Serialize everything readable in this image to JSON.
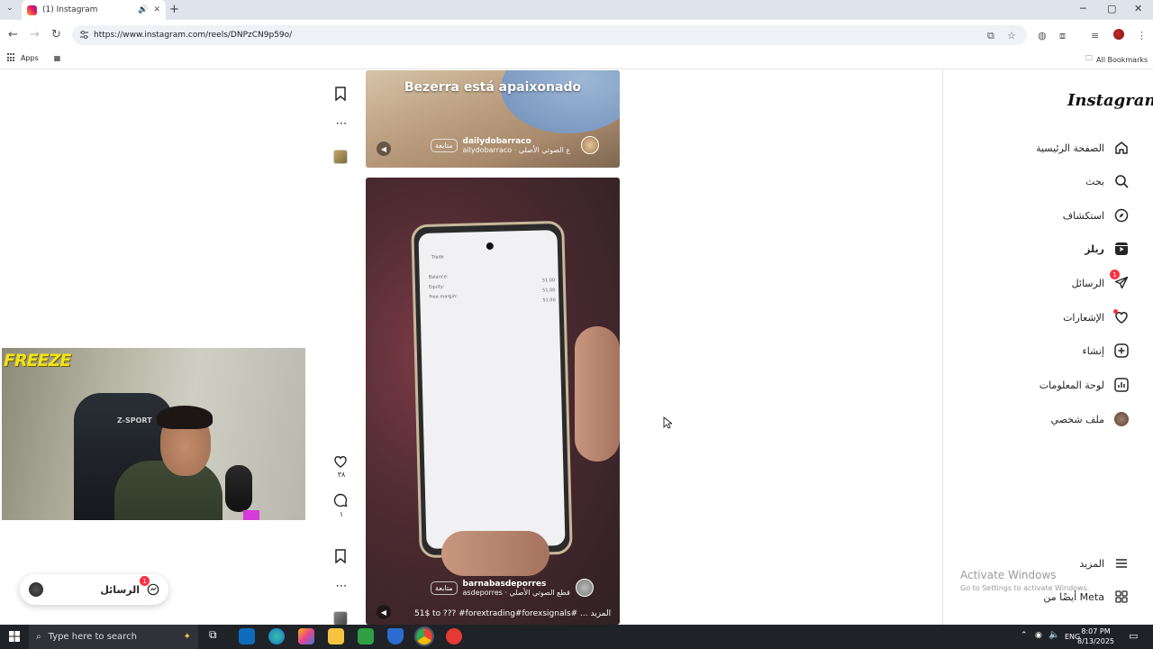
{
  "browser": {
    "tab_title": "(1) Instagram",
    "url": "https://www.instagram.com/reels/DNPzCN9p59o/",
    "bookmarks_apps": "Apps",
    "all_bookmarks": "All Bookmarks"
  },
  "instagram": {
    "logo": "Instagram",
    "nav": [
      {
        "label": "الصفحة الرئيسية",
        "icon": "home-icon"
      },
      {
        "label": "بحث",
        "icon": "search-icon"
      },
      {
        "label": "استكشاف",
        "icon": "explore-icon"
      },
      {
        "label": "ريلز",
        "icon": "reels-icon",
        "active": true
      },
      {
        "label": "الرسائل",
        "icon": "messages-icon",
        "badge": "1"
      },
      {
        "label": "الإشعارات",
        "icon": "heart-icon"
      },
      {
        "label": "إنشاء",
        "icon": "create-icon"
      },
      {
        "label": "لوحة المعلومات",
        "icon": "dashboard-icon"
      },
      {
        "label": "ملف شخصي",
        "icon": "profile-avatar"
      }
    ],
    "more": "المزيد",
    "meta": "أيضًا من Meta"
  },
  "reels": [
    {
      "caption": "Bezerra está apaixonado",
      "username": "dailydobarraco",
      "audio": "ailydobarraco · ع الصوتي الأصلي",
      "follow": "متابعة"
    },
    {
      "username": "barnabasdeporres",
      "audio": "asdeporres · قطع الصوتي الأصلي",
      "follow": "متابعة",
      "description": "51$ to ??? #forextrading#forexsignals# ... المزيد",
      "likes": "٣٨",
      "comments": "١",
      "phone_lines": [
        "Balance:",
        "Equity:",
        "Free margin:"
      ],
      "phone_values": [
        "51.00",
        "51.00",
        "51.00"
      ],
      "phone_header": "Trade"
    }
  ],
  "webcam": {
    "overlay_text": "FREEZE",
    "chair_brand": "Z-SPORT"
  },
  "messages_pill": {
    "label": "الرسائل",
    "badge": "1"
  },
  "watermark": {
    "title": "Activate Windows",
    "subtitle": "Go to Settings to activate Windows."
  },
  "taskbar": {
    "search_placeholder": "Type here to search",
    "lang": "ENG",
    "time": "8:07 PM",
    "date": "8/13/2025"
  }
}
